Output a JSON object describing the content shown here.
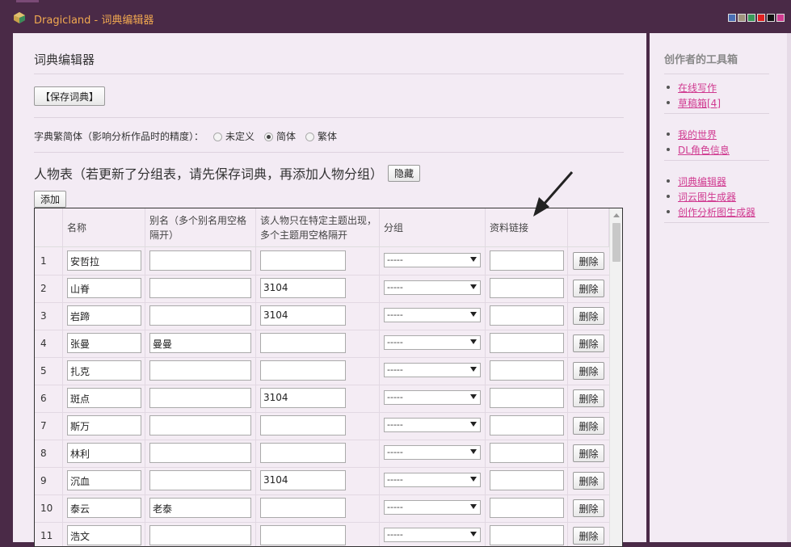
{
  "window": {
    "title": "Dragicland - 词典编辑器",
    "swatch_colors": [
      "#4a6fb5",
      "#a0937d",
      "#3a9a5a",
      "#e02020",
      "#111111",
      "#d03a90"
    ]
  },
  "main": {
    "title": "词典编辑器",
    "save_button": "【保存词典】",
    "script_label": "字典繁简体（影响分析作品时的精度）：",
    "script_options": [
      "未定义",
      "简体",
      "繁体"
    ],
    "script_selected": "简体",
    "people_title": "人物表（若更新了分组表，请先保存词典，再添加人物分组）",
    "hide_button": "隐藏",
    "add_button": "添加",
    "columns": [
      "名称",
      "别名（多个别名用空格隔开）",
      "该人物只在特定主题出现，多个主题用空格隔开",
      "分组",
      "资料链接"
    ],
    "group_placeholder": "-----",
    "delete_label": "删除",
    "rows": [
      {
        "n": "1",
        "name": "安哲拉",
        "alias": "",
        "topic": ""
      },
      {
        "n": "2",
        "name": "山脊",
        "alias": "",
        "topic": "3104"
      },
      {
        "n": "3",
        "name": "岩蹄",
        "alias": "",
        "topic": "3104"
      },
      {
        "n": "4",
        "name": "张曼",
        "alias": "曼曼",
        "topic": ""
      },
      {
        "n": "5",
        "name": "扎克",
        "alias": "",
        "topic": ""
      },
      {
        "n": "6",
        "name": "斑点",
        "alias": "",
        "topic": "3104"
      },
      {
        "n": "7",
        "name": "斯万",
        "alias": "",
        "topic": ""
      },
      {
        "n": "8",
        "name": "林利",
        "alias": "",
        "topic": ""
      },
      {
        "n": "9",
        "name": "沉血",
        "alias": "",
        "topic": "3104"
      },
      {
        "n": "10",
        "name": "泰云",
        "alias": "老泰",
        "topic": ""
      },
      {
        "n": "11",
        "name": "浩文",
        "alias": "",
        "topic": ""
      }
    ]
  },
  "sidebar": {
    "title": "创作者的工具箱",
    "groups": [
      [
        "在线写作",
        "草稿箱[4]"
      ],
      [
        "我的世界",
        "DL角色信息"
      ],
      [
        "词典编辑器",
        "词云图生成器",
        "创作分析图生成器"
      ]
    ]
  },
  "colors": {
    "accent": "#d03a90",
    "topbar": "#4a2a47",
    "title": "#f0a850"
  }
}
